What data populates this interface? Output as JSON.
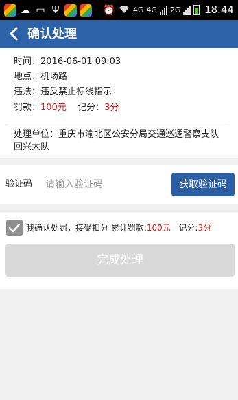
{
  "status_bar": {
    "network_a": "4G",
    "network_b": "4G",
    "network_c": "2G",
    "time": "18:44"
  },
  "header": {
    "back_icon": "chevron-left-icon",
    "title": "确认处理"
  },
  "violation": {
    "time_label": "时间：",
    "time_value": "2016-06-01 09:03",
    "location_label": "地点：",
    "location_value": "机场路",
    "violation_label": "违法：",
    "violation_value": "违反禁止标线指示",
    "fine_label": "罚款：",
    "fine_value": "100元",
    "points_label": "记分：",
    "points_value": "3分",
    "unit_label": "处理单位：",
    "unit_value": "重庆市渝北区公安分局交通巡逻警察支队回兴大队"
  },
  "verify": {
    "label": "验证码",
    "placeholder": "请输入验证码",
    "value": "",
    "get_code_label": "获取验证码"
  },
  "confirm": {
    "checked": true,
    "text_main": "我确认处罚，接受扣分 累计罚款:",
    "fine_total": "100元",
    "points_label": "记分:",
    "points_total": "3分",
    "finish_label": "完成处理"
  },
  "colors": {
    "header_bg": "#2c63a8",
    "accent_red": "#e01414",
    "button_blue": "#2c5ea3",
    "disabled_gray": "#d9d9d9"
  }
}
